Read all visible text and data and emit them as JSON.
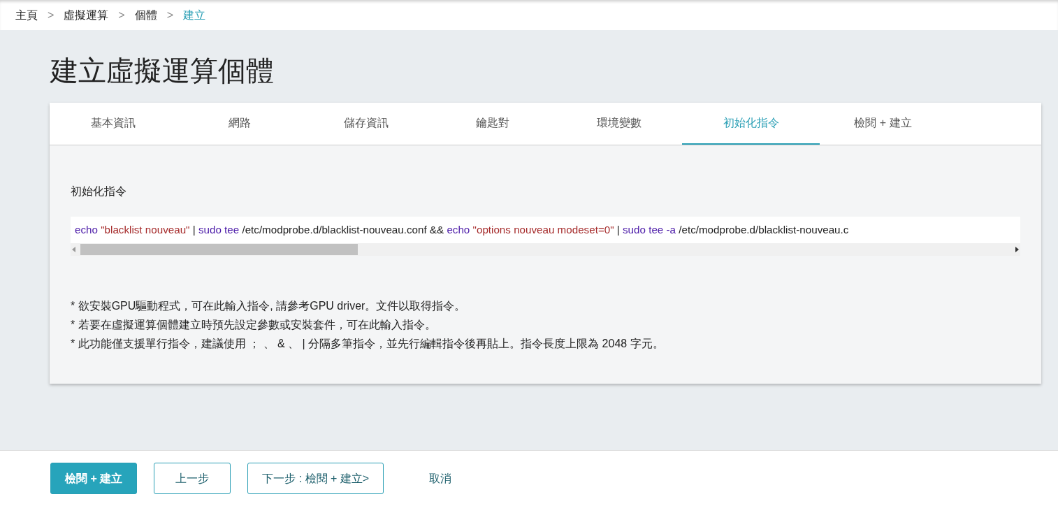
{
  "breadcrumb": [
    {
      "label": "主頁",
      "selected": false
    },
    {
      "label": "虛擬運算",
      "selected": false
    },
    {
      "label": "個體",
      "selected": false
    },
    {
      "label": "建立",
      "selected": true
    }
  ],
  "breadcrumb_separator": ">",
  "title": "建立虛擬運算個體",
  "tabs": [
    {
      "label": "基本資訊",
      "selected": false
    },
    {
      "label": "網路",
      "selected": false
    },
    {
      "label": "儲存資訊",
      "selected": false
    },
    {
      "label": "鑰匙對",
      "selected": false
    },
    {
      "label": "環境變數",
      "selected": false
    },
    {
      "label": "初始化指令",
      "selected": true
    },
    {
      "label": "檢閱 + 建立",
      "selected": false
    }
  ],
  "section_label": "初始化指令",
  "command": [
    {
      "kind": "keyword",
      "text": "echo"
    },
    {
      "kind": "string",
      "text": "\"blacklist nouveau\""
    },
    {
      "kind": "plain",
      "text": "|"
    },
    {
      "kind": "keyword",
      "text": "sudo tee"
    },
    {
      "kind": "plain",
      "text": "/etc/modprobe.d/blacklist-nouveau.conf &&"
    },
    {
      "kind": "keyword",
      "text": "echo"
    },
    {
      "kind": "string",
      "text": "\"options nouveau modeset=0\""
    },
    {
      "kind": "plain",
      "text": "|"
    },
    {
      "kind": "keyword",
      "text": "sudo tee -a"
    },
    {
      "kind": "plain",
      "text": "/etc/modprobe.d/blacklist-nouveau.c"
    }
  ],
  "notes": [
    {
      "before": "* 欲安裝GPU驅動程式，可在此輸入指令, 請參考",
      "link": "GPU driver",
      "after": "。文件以取得指令。"
    },
    {
      "before": "* 若要在虛擬運算個體建立時預先設定參數或安裝套件，可在此輸入指令。"
    },
    {
      "before": "* 此功能僅支援單行指令，建議使用 ； 、 & 、 | 分隔多筆指令，並先行編輯指令後再貼上。指令長度上限為 2048 字元。"
    }
  ],
  "buttons": [
    {
      "label": "檢閱 + 建立",
      "kind": "primary"
    },
    {
      "label": "上一步",
      "kind": "outline"
    },
    {
      "label": "下一步 : 檢閱 + 建立>",
      "kind": "outline"
    },
    {
      "label": "取消",
      "kind": "link"
    }
  ]
}
